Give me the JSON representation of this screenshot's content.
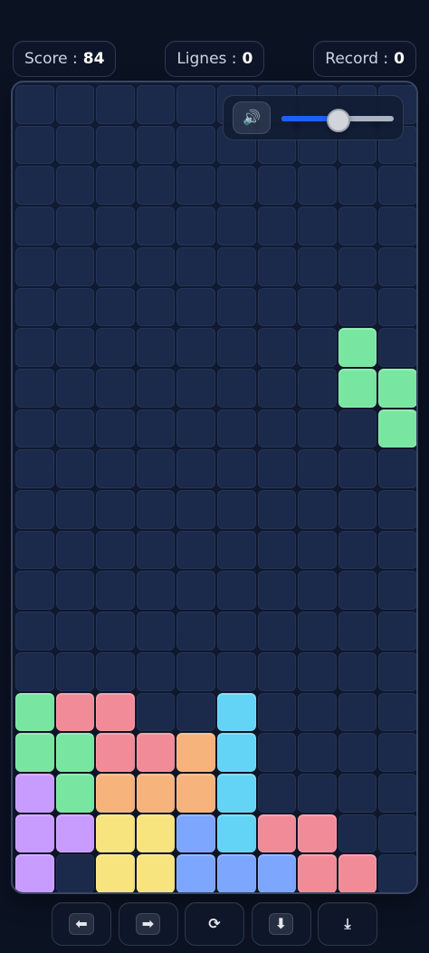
{
  "stats": {
    "score_label": "Score :",
    "score_value": "84",
    "lines_label": "Lignes :",
    "lines_value": "0",
    "record_label": "Record :",
    "record_value": "0"
  },
  "audio": {
    "mute_icon": "🔊",
    "volume_percent": 51
  },
  "controls": {
    "left_glyph": "⬅",
    "right_glyph": "➡",
    "rotate_glyph": "⟳",
    "soft_drop_glyph": "⬇",
    "hard_drop_glyph": "⤓"
  },
  "colors": {
    "green": "#78e6a0",
    "pink": "#f28b98",
    "blue_cyan": "#63d4f5",
    "orange": "#f6b37c",
    "purple": "#c89bff",
    "yellow": "#f8e47e",
    "blue": "#7ca6ff"
  },
  "board": {
    "cols": 10,
    "rows": 20,
    "filled": [
      {
        "r": 6,
        "c": 8,
        "color": "green"
      },
      {
        "r": 7,
        "c": 8,
        "color": "green"
      },
      {
        "r": 7,
        "c": 9,
        "color": "green"
      },
      {
        "r": 8,
        "c": 9,
        "color": "green"
      },
      {
        "r": 15,
        "c": 0,
        "color": "green"
      },
      {
        "r": 15,
        "c": 1,
        "color": "pink"
      },
      {
        "r": 15,
        "c": 2,
        "color": "pink"
      },
      {
        "r": 15,
        "c": 5,
        "color": "blue_cyan"
      },
      {
        "r": 16,
        "c": 0,
        "color": "green"
      },
      {
        "r": 16,
        "c": 1,
        "color": "green"
      },
      {
        "r": 16,
        "c": 2,
        "color": "pink"
      },
      {
        "r": 16,
        "c": 3,
        "color": "pink"
      },
      {
        "r": 16,
        "c": 4,
        "color": "orange"
      },
      {
        "r": 16,
        "c": 5,
        "color": "blue_cyan"
      },
      {
        "r": 17,
        "c": 0,
        "color": "purple"
      },
      {
        "r": 17,
        "c": 1,
        "color": "green"
      },
      {
        "r": 17,
        "c": 2,
        "color": "orange"
      },
      {
        "r": 17,
        "c": 3,
        "color": "orange"
      },
      {
        "r": 17,
        "c": 4,
        "color": "orange"
      },
      {
        "r": 17,
        "c": 5,
        "color": "blue_cyan"
      },
      {
        "r": 18,
        "c": 0,
        "color": "purple"
      },
      {
        "r": 18,
        "c": 1,
        "color": "purple"
      },
      {
        "r": 18,
        "c": 2,
        "color": "yellow"
      },
      {
        "r": 18,
        "c": 3,
        "color": "yellow"
      },
      {
        "r": 18,
        "c": 4,
        "color": "blue"
      },
      {
        "r": 18,
        "c": 5,
        "color": "blue_cyan"
      },
      {
        "r": 18,
        "c": 6,
        "color": "pink"
      },
      {
        "r": 18,
        "c": 7,
        "color": "pink"
      },
      {
        "r": 19,
        "c": 0,
        "color": "purple"
      },
      {
        "r": 19,
        "c": 2,
        "color": "yellow"
      },
      {
        "r": 19,
        "c": 3,
        "color": "yellow"
      },
      {
        "r": 19,
        "c": 4,
        "color": "blue"
      },
      {
        "r": 19,
        "c": 5,
        "color": "blue"
      },
      {
        "r": 19,
        "c": 6,
        "color": "blue"
      },
      {
        "r": 19,
        "c": 7,
        "color": "pink"
      },
      {
        "r": 19,
        "c": 8,
        "color": "pink"
      }
    ]
  }
}
